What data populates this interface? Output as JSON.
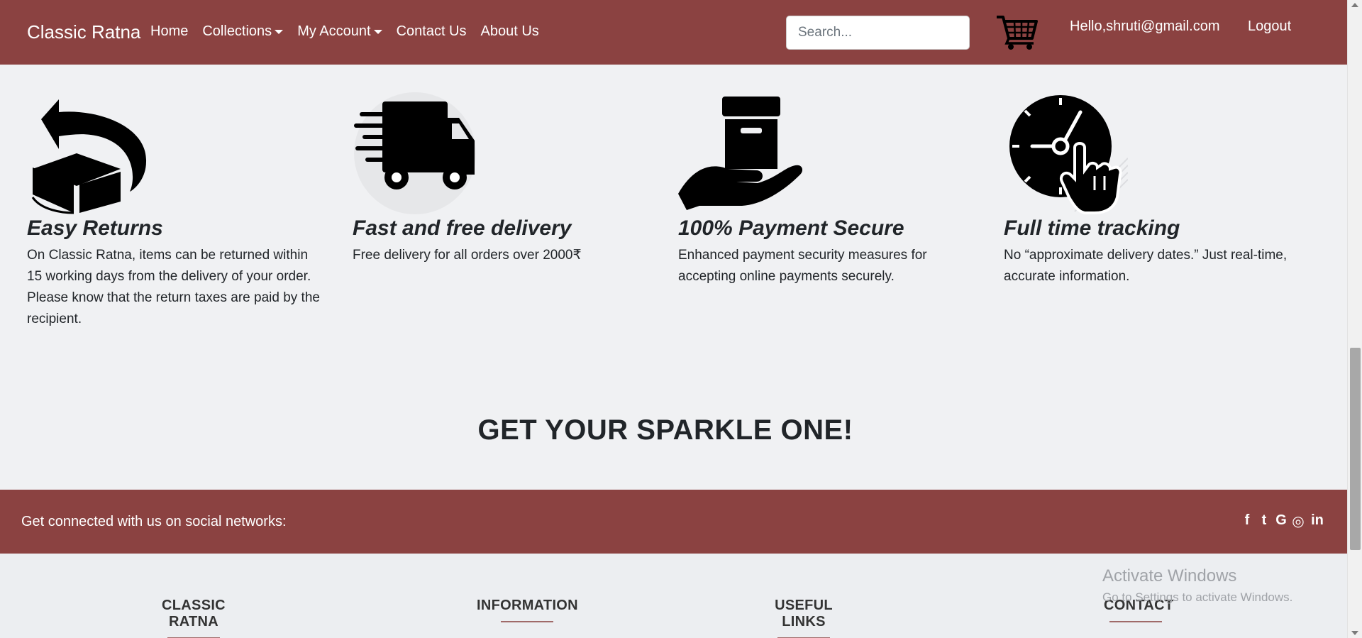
{
  "navbar": {
    "brand": "Classic Ratna",
    "links": [
      {
        "label": "Home"
      },
      {
        "label": "Collections",
        "dropdown": true
      },
      {
        "label": "My Account",
        "dropdown": true
      },
      {
        "label": "Contact Us"
      },
      {
        "label": "About Us"
      }
    ],
    "search_placeholder": "Search...",
    "cart_icon": "shopping-cart-icon",
    "greeting": "Hello,shruti@gmail.com",
    "logout": "Logout"
  },
  "features": [
    {
      "icon": "return-box-icon",
      "title": "Easy Returns",
      "lines": [
        "On Classic Ratna, items can be returned within 15 working days from the delivery of your order.",
        "Please know that the return taxes are paid by the recipient."
      ]
    },
    {
      "icon": "delivery-truck-icon",
      "title": "Fast and free delivery",
      "lines": [
        "Free delivery for all orders over 2000₹"
      ]
    },
    {
      "icon": "secure-payment-icon",
      "title": "100% Payment Secure",
      "lines": [
        "Enhanced payment security measures for accepting online payments securely."
      ]
    },
    {
      "icon": "tracking-clock-icon",
      "title": "Full time tracking",
      "lines": [
        "No “approximate delivery dates.” Just real-time, accurate information."
      ]
    }
  ],
  "sparkle_heading": "GET YOUR SPARKLE ONE!",
  "social": {
    "text": "Get connected with us on social networks:",
    "icons": [
      "facebook-icon",
      "twitter-icon",
      "google-icon",
      "instagram-icon",
      "linkedin-icon"
    ],
    "glyphs": [
      "f",
      "t",
      "G",
      "◎",
      "in"
    ]
  },
  "footer": {
    "columns": [
      "CLASSIC RATNA",
      "INFORMATION",
      "USEFUL LINKS",
      "CONTACT"
    ]
  },
  "watermark": {
    "line1": "Activate Windows",
    "line2": "Go to Settings to activate Windows."
  },
  "colors": {
    "brand_maroon": "#8b4241",
    "page_bg": "#f0f1f3"
  }
}
